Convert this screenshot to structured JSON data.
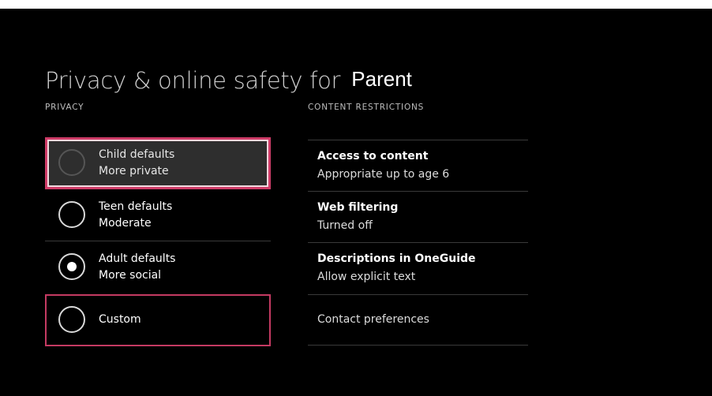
{
  "page": {
    "title": "Privacy & online safety for",
    "user": "Parent"
  },
  "privacy": {
    "header": "PRIVACY",
    "options": [
      {
        "line1": "Child defaults",
        "line2": "More private",
        "selected": false,
        "focused": true
      },
      {
        "line1": "Teen defaults",
        "line2": "Moderate",
        "selected": false,
        "focused": false
      },
      {
        "line1": "Adult defaults",
        "line2": "More social",
        "selected": true,
        "focused": false
      },
      {
        "line1": "Custom",
        "line2": "",
        "selected": false,
        "focused": false
      }
    ]
  },
  "content": {
    "header": "CONTENT RESTRICTIONS",
    "rows": [
      {
        "heading": "Access to content",
        "value": "Appropriate up to age 6"
      },
      {
        "heading": "Web filtering",
        "value": "Turned off"
      },
      {
        "heading": "Descriptions in OneGuide",
        "value": "Allow explicit text"
      },
      {
        "label": "Contact preferences"
      }
    ]
  },
  "colors": {
    "background": "#000000",
    "focus_border": "#ce3b67",
    "focused_fill": "#2e2e2e",
    "text": "#ffffff",
    "divider": "#3a3a3a"
  }
}
